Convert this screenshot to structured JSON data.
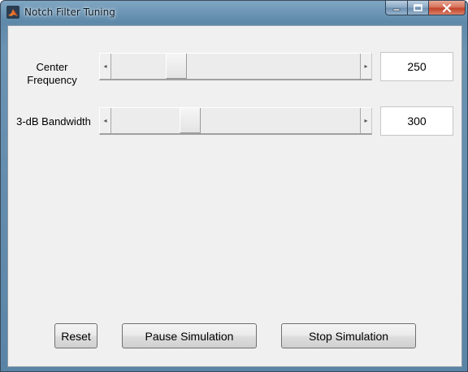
{
  "window": {
    "title": "Notch Filter Tuning",
    "icon": "matlab-icon",
    "controls": {
      "minimize_icon": "minimize-icon",
      "maximize_icon": "maximize-icon",
      "close_icon": "close-icon"
    }
  },
  "controls": {
    "center_frequency": {
      "label_line1": "Center",
      "label_line2": "Frequency",
      "value": "250",
      "slider_fraction": 0.24
    },
    "bandwidth": {
      "label": "3-dB Bandwidth",
      "value": "300",
      "slider_fraction": 0.3
    }
  },
  "buttons": {
    "reset": "Reset",
    "pause": "Pause Simulation",
    "stop": "Stop Simulation"
  },
  "colors": {
    "titlebar": "#6b93b2",
    "client_bg": "#f0f0f0",
    "close_button": "#c2442a"
  }
}
